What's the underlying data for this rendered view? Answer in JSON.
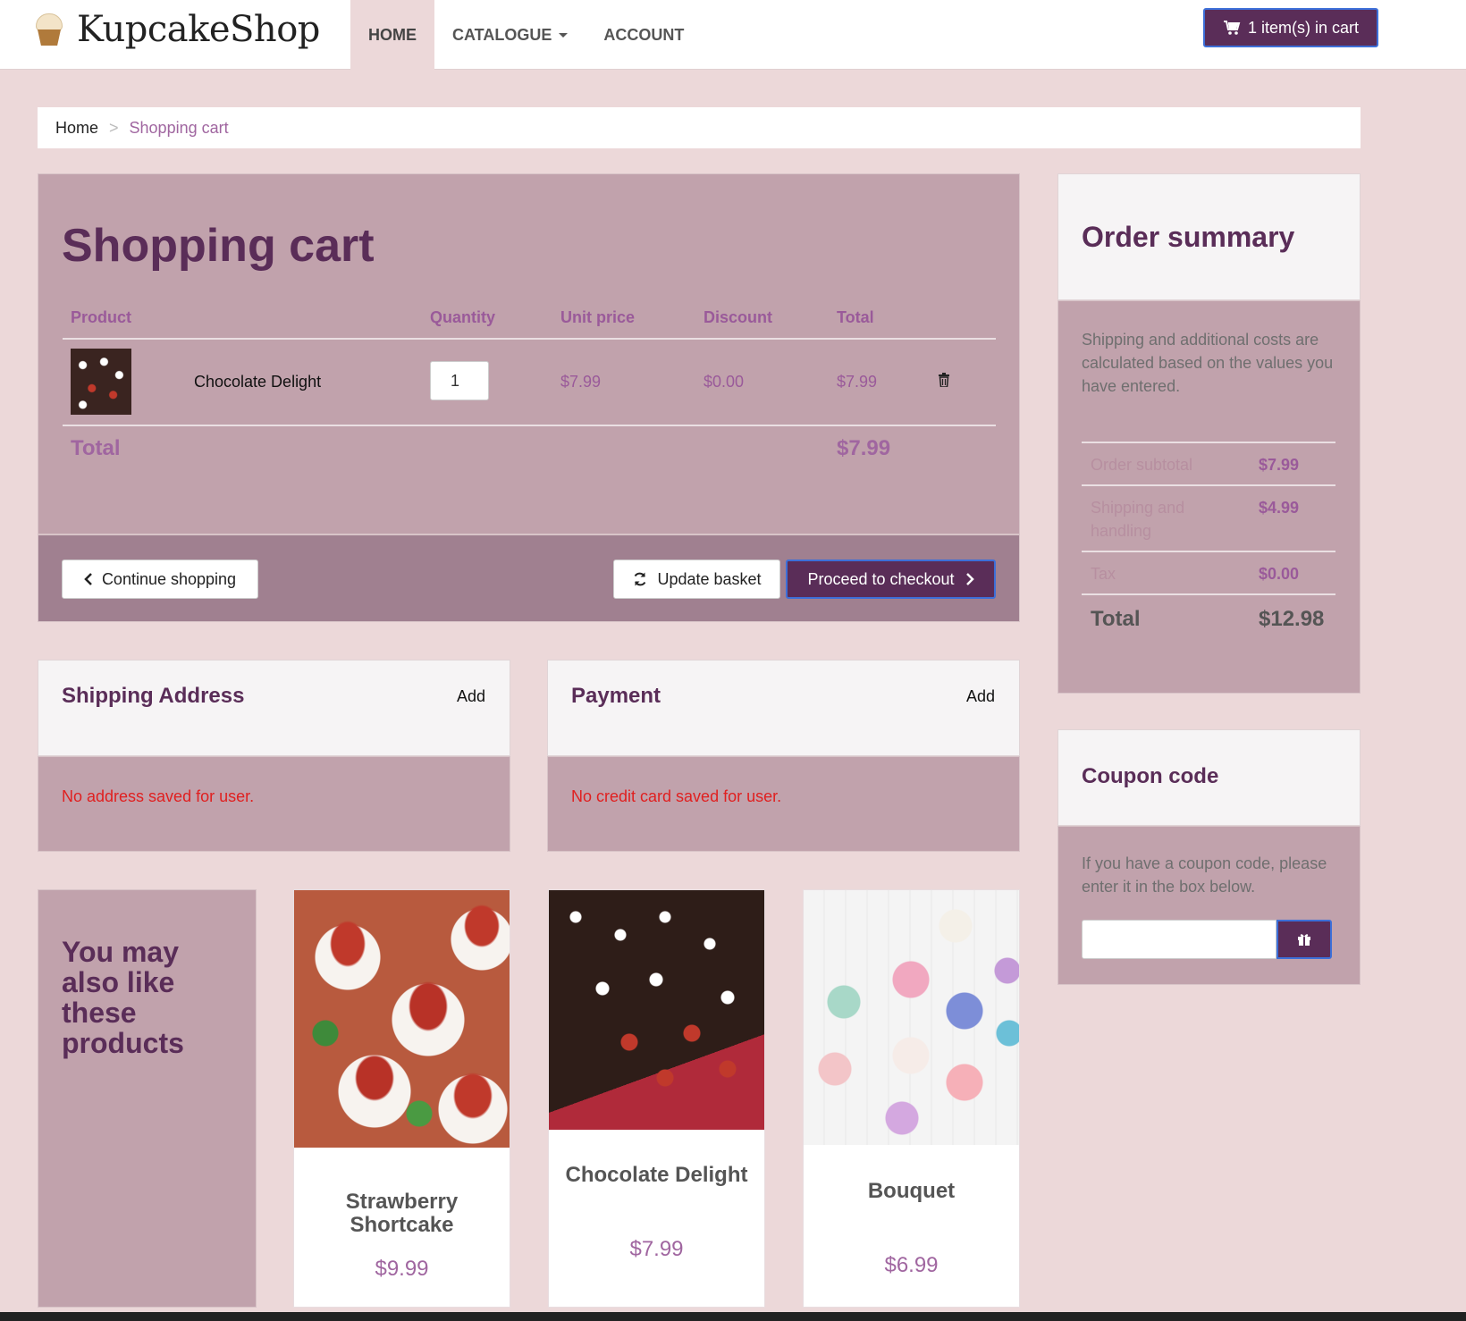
{
  "header": {
    "logo_text": "KupcakeShop",
    "nav": [
      {
        "label": "HOME"
      },
      {
        "label": "CATALOGUE"
      },
      {
        "label": "ACCOUNT"
      }
    ],
    "cart_button": "1 item(s) in cart"
  },
  "breadcrumb": {
    "home": "Home",
    "separator": ">",
    "current": "Shopping cart"
  },
  "cart": {
    "title": "Shopping cart",
    "columns": {
      "product": "Product",
      "quantity": "Quantity",
      "unit_price": "Unit price",
      "discount": "Discount",
      "total": "Total"
    },
    "items": [
      {
        "name": "Chocolate Delight",
        "quantity": "1",
        "unit_price": "$7.99",
        "discount": "$0.00",
        "total": "$7.99"
      }
    ],
    "total_label": "Total",
    "total_value": "$7.99",
    "continue_label": "Continue shopping",
    "update_label": "Update basket",
    "checkout_label": "Proceed to checkout"
  },
  "shipping": {
    "title": "Shipping Address",
    "add": "Add",
    "message": "No address saved for user."
  },
  "payment": {
    "title": "Payment",
    "add": "Add",
    "message": "No credit card saved for user."
  },
  "summary": {
    "title": "Order summary",
    "note": "Shipping and additional costs are calculated based on the values you have entered.",
    "rows": [
      {
        "label": "Order subtotal",
        "value": "$7.99"
      },
      {
        "label": "Shipping and handling",
        "value": "$4.99"
      },
      {
        "label": "Tax",
        "value": "$0.00"
      }
    ],
    "total_label": "Total",
    "total_value": "$12.98"
  },
  "coupon": {
    "title": "Coupon code",
    "note": "If you have a coupon code, please enter it in the box below.",
    "value": "",
    "button_icon": "gift-icon"
  },
  "suggestions": {
    "title": "You may also like these products",
    "products": [
      {
        "name": "Strawberry Shortcake",
        "price": "$9.99"
      },
      {
        "name": "Chocolate Delight",
        "price": "$7.99"
      },
      {
        "name": "Bouquet",
        "price": "$6.99"
      }
    ]
  },
  "colors": {
    "brand": "#5a2d58",
    "panel": "#c1a2ac",
    "background": "#ecd8d9",
    "error": "#e02020",
    "accent_text": "#a066a0"
  }
}
